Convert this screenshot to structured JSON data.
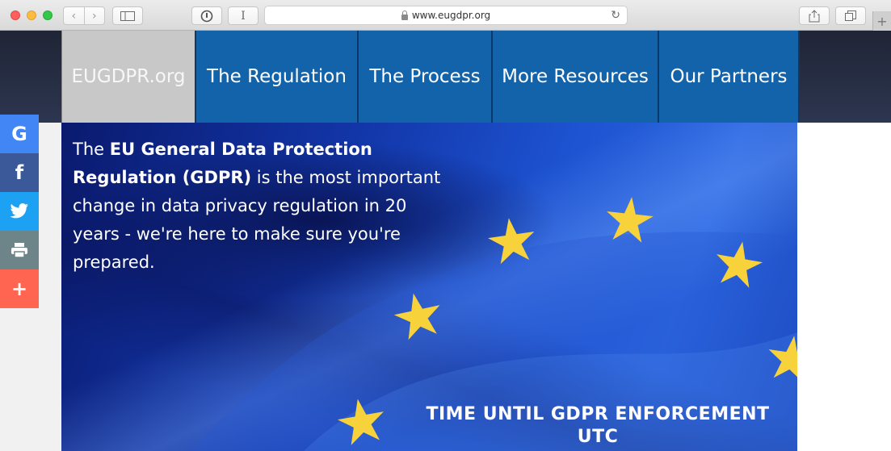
{
  "browser": {
    "url": "www.eugdpr.org",
    "reader_label": "I"
  },
  "nav": {
    "home": "EUGDPR.org",
    "items": [
      "The Regulation",
      "The Process",
      "More Resources",
      "Our Partners"
    ]
  },
  "hero": {
    "intro": "The ",
    "bold": "EU General Data Protection Regulation (GDPR)",
    "rest": " is the most important change in data privacy regulation in 20 years - we're here to make sure you're prepared.",
    "countdown_title": "TIME UNTIL GDPR ENFORCEMENT UTC"
  },
  "social": {
    "google": "G",
    "facebook": "f",
    "more": "+"
  },
  "colors": {
    "nav_blue": "#1363aa",
    "nav_home_bg": "#c8c8c8",
    "google": "#4285f4",
    "facebook": "#3b5998",
    "twitter": "#1da1f2",
    "print": "#6d8489",
    "more": "#ff6550",
    "star": "#f7d23a"
  }
}
